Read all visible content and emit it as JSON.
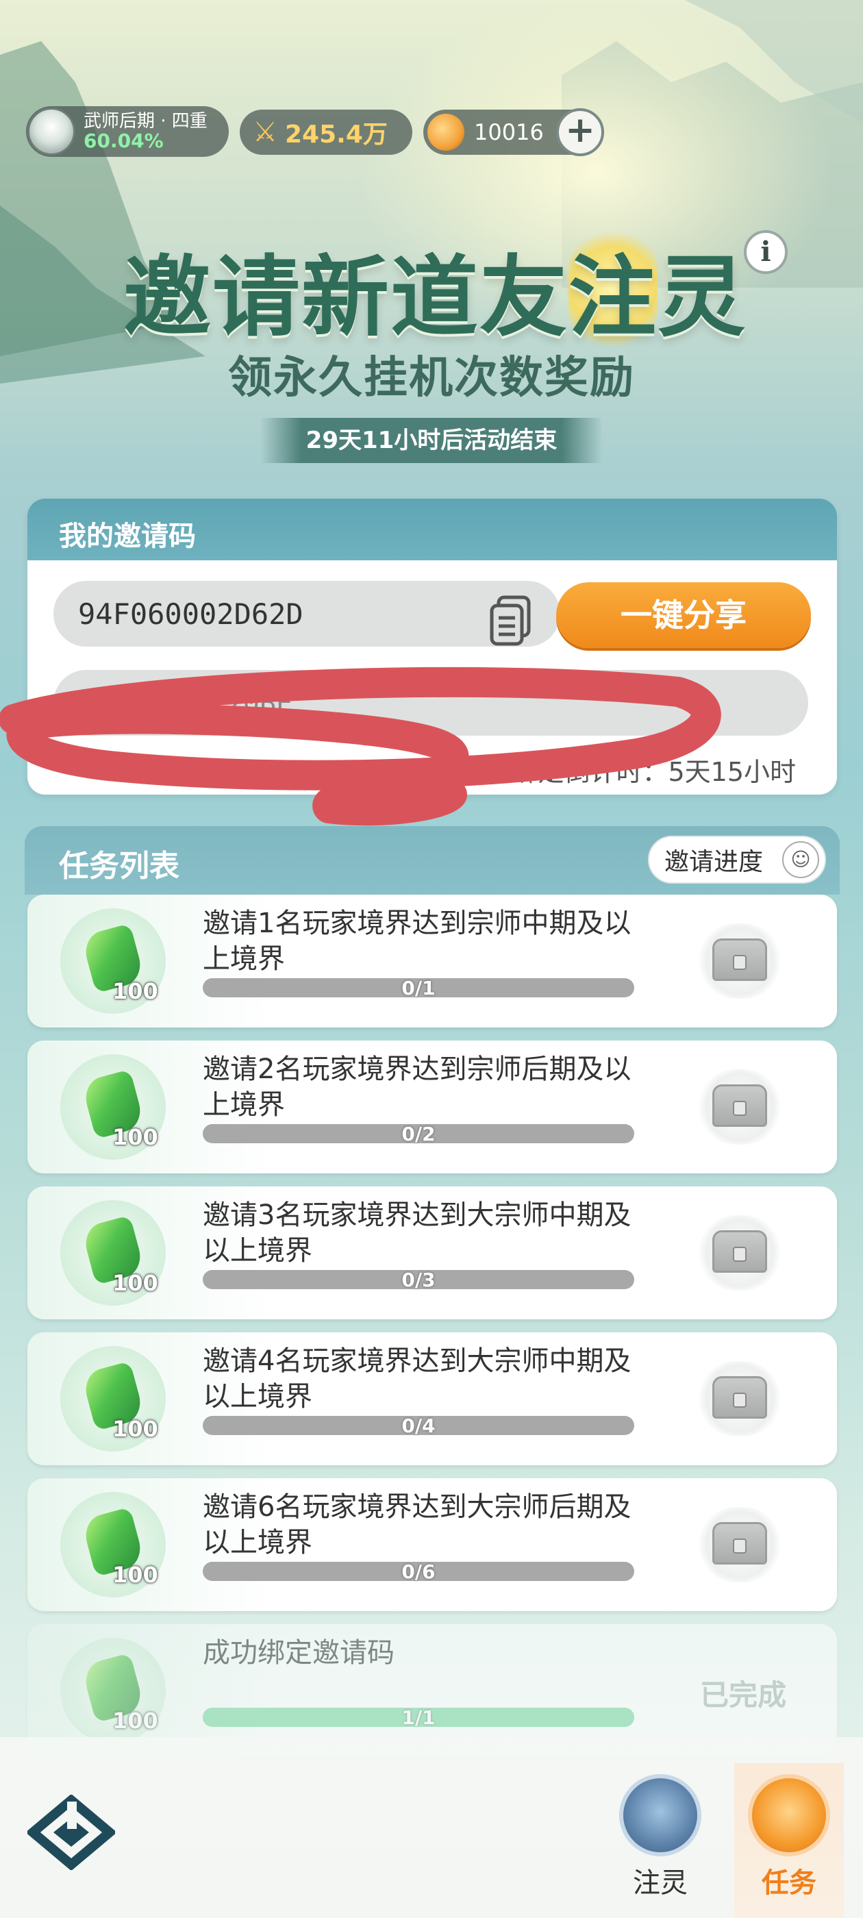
{
  "header": {
    "realm_name": "武师后期 · 四重",
    "realm_progress_text": "60.04%",
    "power_value": "245.4万",
    "coin_value": "10016",
    "plus_label": "+"
  },
  "hero": {
    "title_part1": "邀请新道友",
    "title_highlight": "注",
    "title_part2": "灵",
    "subtitle": "领永久挂机次数奖励",
    "countdown": "29天11小时后活动结束",
    "info_label": "i"
  },
  "invite": {
    "heading": "我的邀请码",
    "my_code": "94F060002D62D",
    "share_label": "一键分享",
    "bound_code": "94ED3000120BE",
    "bind_timer": "绑定倒计时：5天15小时"
  },
  "tasks": {
    "heading": "任务列表",
    "progress_button": "邀请进度",
    "items": [
      {
        "desc": "邀请1名玩家境界达到宗师中期及以上境界",
        "reward_qty": "100",
        "progress": "0/1",
        "fraction": 0,
        "status": ""
      },
      {
        "desc": "邀请2名玩家境界达到宗师后期及以上境界",
        "reward_qty": "100",
        "progress": "0/2",
        "fraction": 0,
        "status": ""
      },
      {
        "desc": "邀请3名玩家境界达到大宗师中期及以上境界",
        "reward_qty": "100",
        "progress": "0/3",
        "fraction": 0,
        "status": ""
      },
      {
        "desc": "邀请4名玩家境界达到大宗师中期及以上境界",
        "reward_qty": "100",
        "progress": "0/4",
        "fraction": 0,
        "status": ""
      },
      {
        "desc": "邀请6名玩家境界达到大宗师后期及以上境界",
        "reward_qty": "100",
        "progress": "0/6",
        "fraction": 0,
        "status": ""
      },
      {
        "desc": "成功绑定邀请码",
        "reward_qty": "100",
        "progress": "1/1",
        "fraction": 1,
        "status": "已完成"
      }
    ]
  },
  "nav": {
    "zhuling_label": "注灵",
    "task_label": "任务"
  },
  "colors": {
    "accent_orange": "#f08a1c",
    "title_green": "#2f6d58",
    "progress_fill": "#7ed8a6"
  }
}
